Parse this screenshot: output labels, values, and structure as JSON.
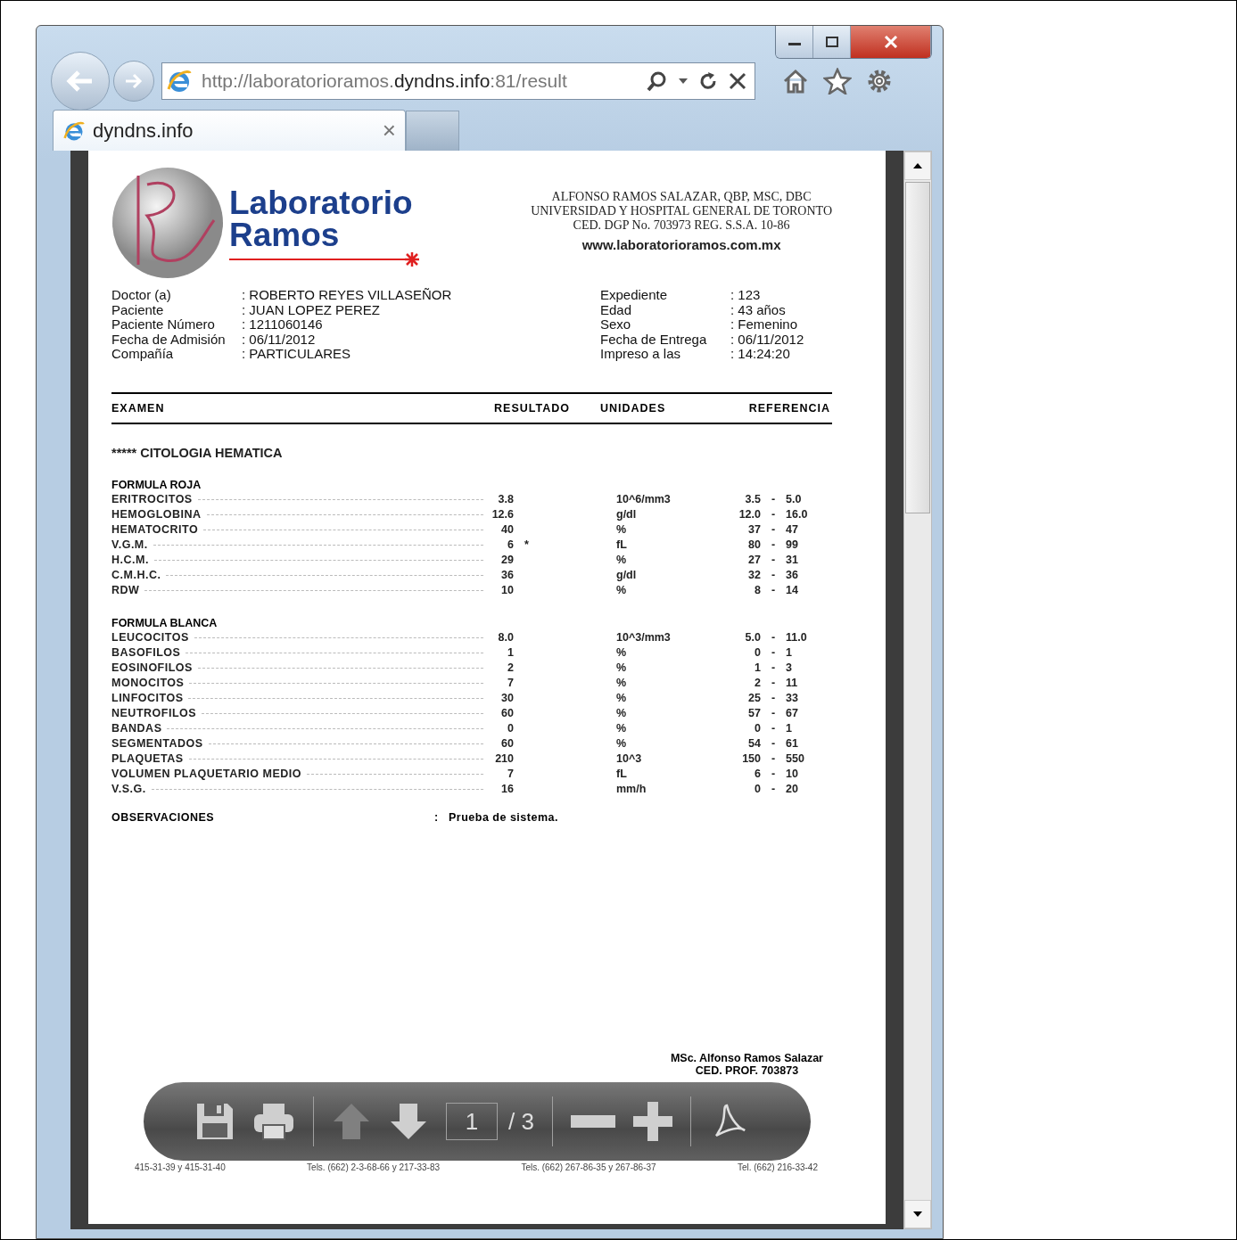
{
  "browser": {
    "address": "http://laboratorioramos.**dyndns.info**:81/result",
    "tabs": [
      {
        "label": "dyndns.info",
        "selected": true,
        "close": "×"
      }
    ]
  },
  "report": {
    "lab_name": [
      "Laboratorio",
      "Ramos"
    ],
    "credentials": [
      "ALFONSO RAMOS SALAZAR, QBP, MSC, DBC",
      "UNIVERSIDAD Y HOSPITAL GENERAL DE TORONTO",
      "CED. DGP No. 703973 REG. S.S.A. 10-86"
    ],
    "website": "www.laboratorioramos.com.mx",
    "info_left": [
      {
        "label": "Doctor (a)",
        "value": ": ROBERTO REYES VILLASEÑOR"
      },
      {
        "label": "Paciente",
        "value": ": JUAN LOPEZ PEREZ"
      },
      {
        "label": "Paciente Número",
        "value": ": 1211060146"
      },
      {
        "label": "Fecha de Admisión",
        "value": ": 06/11/2012"
      },
      {
        "label": "Compañía",
        "value": ": PARTICULARES"
      }
    ],
    "info_right": [
      {
        "label": "Expediente",
        "value": ": 123"
      },
      {
        "label": "Edad",
        "value": ": 43 años"
      },
      {
        "label": "Sexo",
        "value": ": Femenino"
      },
      {
        "label": "Fecha de Entrega",
        "value": ": 06/11/2012"
      },
      {
        "label": "Impreso a las",
        "value": ": 14:24:20"
      }
    ],
    "columns": [
      "EXAMEN",
      "RESULTADO",
      "UNIDADES",
      "REFERENCIA"
    ],
    "section": "***** CITOLOGIA HEMATICA",
    "groups": [
      {
        "title": "FORMULA ROJA",
        "rows": [
          {
            "name": "ERITROCITOS",
            "result": "3.8",
            "flag": "",
            "unit": "10^6/mm3",
            "low": "3.5",
            "high": "5.0"
          },
          {
            "name": "HEMOGLOBINA",
            "result": "12.6",
            "flag": "",
            "unit": "g/dl",
            "low": "12.0",
            "high": "16.0"
          },
          {
            "name": "HEMATOCRITO",
            "result": "40",
            "flag": "",
            "unit": "%",
            "low": "37",
            "high": "47"
          },
          {
            "name": "V.G.M.",
            "result": "6",
            "flag": "*",
            "unit": "fL",
            "low": "80",
            "high": "99"
          },
          {
            "name": "H.C.M.",
            "result": "29",
            "flag": "",
            "unit": "%",
            "low": "27",
            "high": "31"
          },
          {
            "name": "C.M.H.C.",
            "result": "36",
            "flag": "",
            "unit": "g/dl",
            "low": "32",
            "high": "36"
          },
          {
            "name": "RDW",
            "result": "10",
            "flag": "",
            "unit": "%",
            "low": "8",
            "high": "14"
          }
        ]
      },
      {
        "title": "FORMULA BLANCA",
        "rows": [
          {
            "name": "LEUCOCITOS",
            "result": "8.0",
            "flag": "",
            "unit": "10^3/mm3",
            "low": "5.0",
            "high": "11.0"
          },
          {
            "name": "BASOFILOS",
            "result": "1",
            "flag": "",
            "unit": "%",
            "low": "0",
            "high": "1"
          },
          {
            "name": "EOSINOFILOS",
            "result": "2",
            "flag": "",
            "unit": "%",
            "low": "1",
            "high": "3"
          },
          {
            "name": "MONOCITOS",
            "result": "7",
            "flag": "",
            "unit": "%",
            "low": "2",
            "high": "11"
          },
          {
            "name": "LINFOCITOS",
            "result": "30",
            "flag": "",
            "unit": "%",
            "low": "25",
            "high": "33"
          },
          {
            "name": "NEUTROFILOS",
            "result": "60",
            "flag": "",
            "unit": "%",
            "low": "57",
            "high": "67"
          },
          {
            "name": "BANDAS",
            "result": "0",
            "flag": "",
            "unit": "%",
            "low": "0",
            "high": "1"
          },
          {
            "name": "SEGMENTADOS",
            "result": "60",
            "flag": "",
            "unit": "%",
            "low": "54",
            "high": "61"
          },
          {
            "name": "PLAQUETAS",
            "result": "210",
            "flag": "",
            "unit": "10^3",
            "low": "150",
            "high": "550"
          },
          {
            "name": "VOLUMEN PLAQUETARIO MEDIO",
            "result": "7",
            "flag": "",
            "unit": "fL",
            "low": "6",
            "high": "10"
          },
          {
            "name": "V.S.G.",
            "result": "16",
            "flag": "",
            "unit": "mm/h",
            "low": "0",
            "high": "20"
          }
        ]
      }
    ],
    "ref_separator": "-",
    "observations": {
      "label": "OBSERVACIONES",
      "colon": ":",
      "text": "Prueba de sistema."
    },
    "signature": [
      "MSc. Alfonso Ramos Salazar",
      "CED. PROF. 703873"
    ],
    "footer": [
      "415-31-39 y 415-31-40",
      "Tels. (662) 2-3-68-66 y 217-33-83",
      "Tels. (662) 267-86-35 y 267-86-37",
      "Tel. (662) 216-33-42"
    ]
  },
  "pdf_toolbar": {
    "page": "1",
    "total": "/ 3"
  }
}
